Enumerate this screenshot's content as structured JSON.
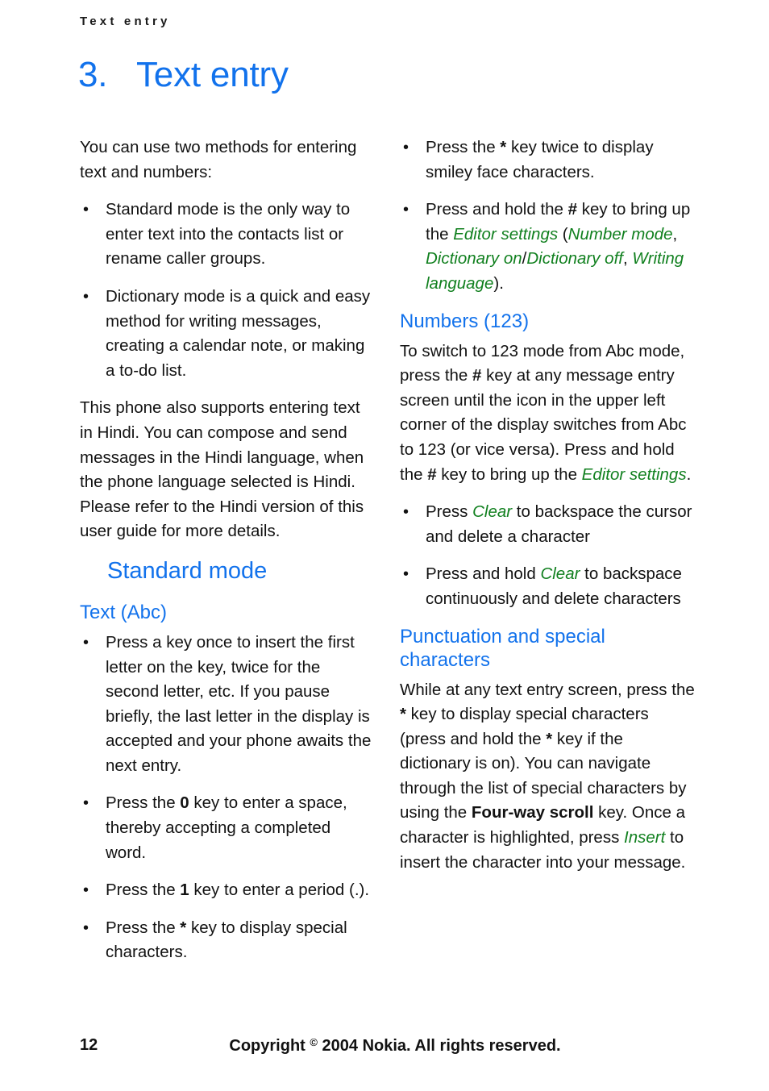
{
  "document": {
    "running_head": "Text entry",
    "chapter_number": "3.",
    "chapter_title": "Text entry",
    "accent_blue": "#1272ec",
    "ui_green": "#11801f",
    "body_black": "#121212"
  },
  "left_column": {
    "intro": "You can use two methods for entering text and numbers:",
    "bullets": [
      "Standard mode is the only way to enter text into the contacts list or rename caller groups.",
      "Dictionary mode is a quick and easy method for writing messages, creating a calendar note, or making a to-do list."
    ],
    "hindi_paragraph": "This phone also supports entering text in Hindi. You can compose and send messages in the Hindi language, when the phone language selected is Hindi. Please refer to the Hindi version of this user guide for more details.",
    "section_heading": "Standard mode",
    "subsection_heading": "Text (Abc)",
    "abc_bullets": [
      {
        "parts": [
          {
            "t": "Press a key once to insert the first letter on the key, twice for the second letter, etc. If you pause briefly, the last letter in the display is accepted and your phone awaits the next entry.",
            "style": "plain"
          }
        ]
      },
      {
        "parts": [
          {
            "t": "Press the ",
            "style": "plain"
          },
          {
            "t": "0",
            "style": "key"
          },
          {
            "t": " key to enter a space, thereby accepting a completed word.",
            "style": "plain"
          }
        ]
      },
      {
        "parts": [
          {
            "t": "Press the ",
            "style": "plain"
          },
          {
            "t": "1",
            "style": "key"
          },
          {
            "t": " key to enter a period (.).",
            "style": "plain"
          }
        ]
      },
      {
        "parts": [
          {
            "t": "Press the ",
            "style": "plain"
          },
          {
            "t": "*",
            "style": "key"
          },
          {
            "t": " key to display special characters.",
            "style": "plain"
          }
        ]
      }
    ]
  },
  "right_column": {
    "top_bullets": [
      {
        "parts": [
          {
            "t": "Press the ",
            "style": "plain"
          },
          {
            "t": "*",
            "style": "key"
          },
          {
            "t": " key twice to display smiley face characters.",
            "style": "plain"
          }
        ]
      },
      {
        "parts": [
          {
            "t": "Press and hold the ",
            "style": "plain"
          },
          {
            "t": "#",
            "style": "key"
          },
          {
            "t": " key to bring up the ",
            "style": "plain"
          },
          {
            "t": "Editor settings",
            "style": "ui"
          },
          {
            "t": " (",
            "style": "plain"
          },
          {
            "t": "Number mode",
            "style": "ui"
          },
          {
            "t": ", ",
            "style": "plain"
          },
          {
            "t": "Dictionary on",
            "style": "ui"
          },
          {
            "t": "/",
            "style": "plain"
          },
          {
            "t": "Dictionary off",
            "style": "ui"
          },
          {
            "t": ", ",
            "style": "plain"
          },
          {
            "t": "Writing language",
            "style": "ui"
          },
          {
            "t": ").",
            "style": "plain"
          }
        ]
      }
    ],
    "numbers_heading": "Numbers (123)",
    "numbers_paragraph": [
      {
        "t": "To switch to 123 mode from Abc mode, press the ",
        "style": "plain"
      },
      {
        "t": "#",
        "style": "key"
      },
      {
        "t": " key at any message entry screen until the icon in the upper left corner of the display switches from Abc to 123 (or vice versa). Press and hold the ",
        "style": "plain"
      },
      {
        "t": "#",
        "style": "key"
      },
      {
        "t": " key to bring up the ",
        "style": "plain"
      },
      {
        "t": "Editor settings",
        "style": "ui"
      },
      {
        "t": ".",
        "style": "plain"
      }
    ],
    "numbers_bullets": [
      {
        "parts": [
          {
            "t": "Press ",
            "style": "plain"
          },
          {
            "t": "Clear",
            "style": "ui"
          },
          {
            "t": " to backspace the cursor and delete a character",
            "style": "plain"
          }
        ]
      },
      {
        "parts": [
          {
            "t": "Press and hold ",
            "style": "plain"
          },
          {
            "t": "Clear",
            "style": "ui"
          },
          {
            "t": " to backspace continuously and delete characters",
            "style": "plain"
          }
        ]
      }
    ],
    "punctuation_heading": "Punctuation and special characters",
    "punctuation_paragraph": [
      {
        "t": "While at any text entry screen, press the ",
        "style": "plain"
      },
      {
        "t": "*",
        "style": "key"
      },
      {
        "t": " key to display special characters (press and hold the ",
        "style": "plain"
      },
      {
        "t": "*",
        "style": "key"
      },
      {
        "t": " key if the dictionary is on). You can navigate through the list of special characters by using the ",
        "style": "plain"
      },
      {
        "t": "Four-way scroll",
        "style": "key"
      },
      {
        "t": " key. Once a character is highlighted, press ",
        "style": "plain"
      },
      {
        "t": "Insert",
        "style": "ui"
      },
      {
        "t": " to insert the character into your message.",
        "style": "plain"
      }
    ]
  },
  "footer": {
    "page_number": "12",
    "copyright_pre": "Copyright ",
    "copyright_symbol": "©",
    "copyright_post": " 2004 Nokia. All rights reserved."
  },
  "icons": {
    "bullet": "•"
  }
}
